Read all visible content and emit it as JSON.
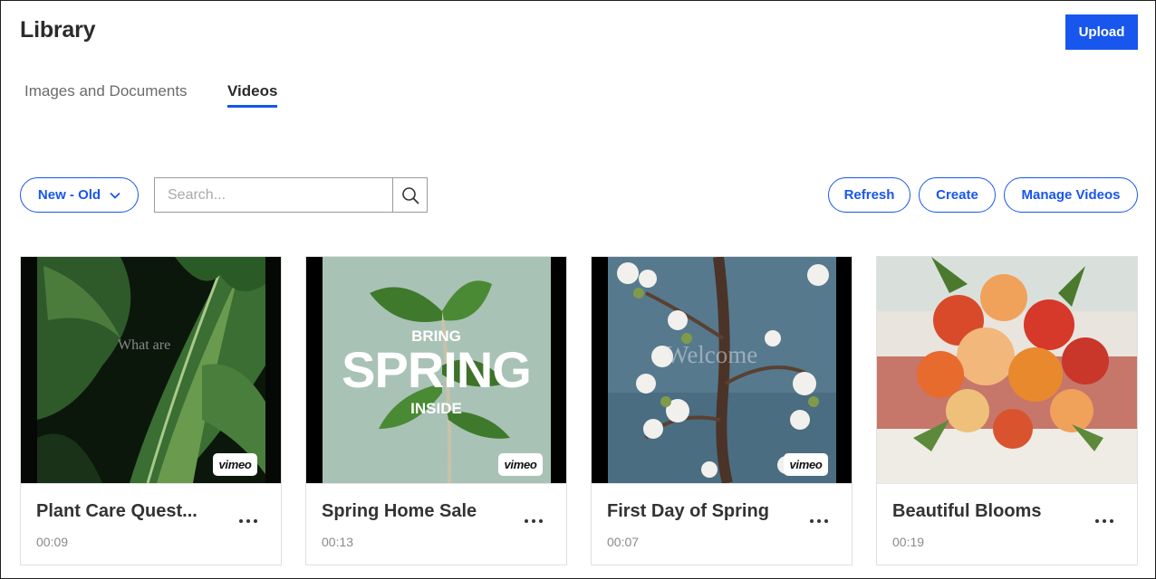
{
  "header": {
    "title": "Library",
    "upload_label": "Upload"
  },
  "tabs": [
    {
      "label": "Images and Documents",
      "active": false
    },
    {
      "label": "Videos",
      "active": true
    }
  ],
  "toolbar": {
    "sort_label": "New - Old",
    "search_placeholder": "Search...",
    "refresh_label": "Refresh",
    "create_label": "Create",
    "manage_label": "Manage Videos"
  },
  "videos": [
    {
      "title": "Plant Care Quest...",
      "duration": "00:09",
      "badge": "vimeo",
      "overlay": "What are"
    },
    {
      "title": "Spring Home Sale",
      "duration": "00:13",
      "badge": "vimeo",
      "overlay_top": "BRING",
      "overlay_main": "SPRING",
      "overlay_bottom": "INSIDE"
    },
    {
      "title": "First Day of Spring",
      "duration": "00:07",
      "badge": "vimeo",
      "overlay": "Welcome"
    },
    {
      "title": "Beautiful Blooms",
      "duration": "00:19"
    }
  ],
  "colors": {
    "accent": "#1856ed",
    "text": "#2b2b2b",
    "muted": "#8a8a8a"
  }
}
